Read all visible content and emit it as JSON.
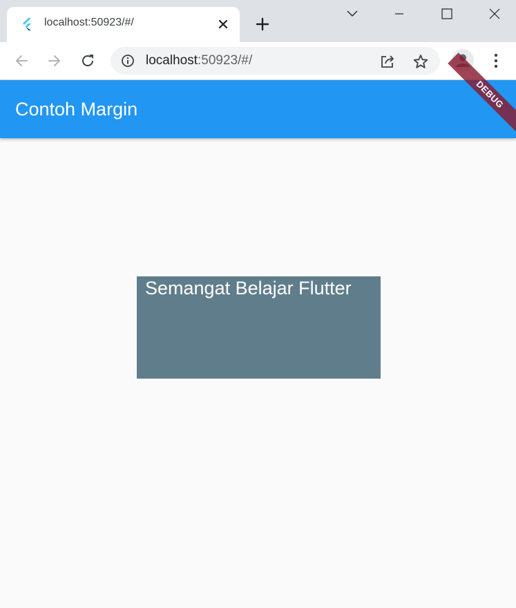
{
  "browser": {
    "tab": {
      "title": "localhost:50923/#/"
    },
    "omnibox": {
      "host": "localhost",
      "path": ":50923/#/"
    }
  },
  "app": {
    "appbar_title": "Contoh Margin",
    "debug_banner": "DEBUG",
    "card_text": "Semangat Belajar Flutter"
  },
  "colors": {
    "appbar": "#2196f3",
    "card": "#607d8b",
    "debug_banner": "#881b31",
    "background": "#fafafa"
  },
  "icons": {
    "favicon": "flutter-logo-icon",
    "tab_close": "close-icon",
    "new_tab": "plus-icon",
    "tab_search": "chevron-down-icon",
    "minimize": "minimize-icon",
    "maximize": "maximize-icon",
    "window_close": "close-icon",
    "back": "arrow-left-icon",
    "forward": "arrow-right-icon",
    "reload": "reload-icon",
    "site_info": "info-icon",
    "share": "share-icon",
    "bookmark": "star-icon",
    "profile": "avatar-icon",
    "menu": "kebab-menu-icon"
  }
}
